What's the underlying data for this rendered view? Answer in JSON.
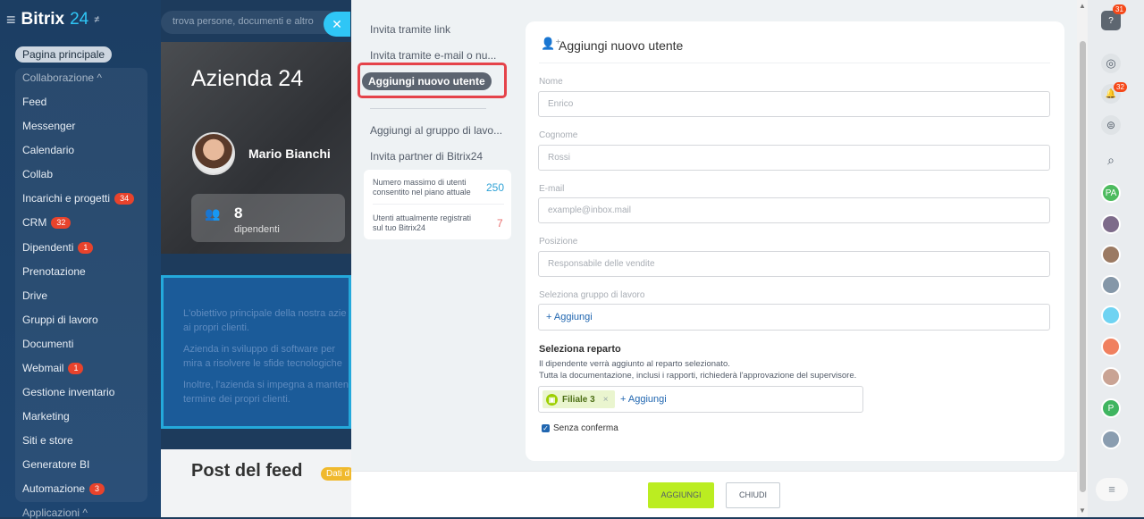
{
  "sidebar": {
    "logo_text": "Bitrix",
    "logo_num": "24",
    "home": "Pagina principale",
    "items": [
      {
        "label": "Collaborazione ^",
        "group": true
      },
      {
        "label": "Feed"
      },
      {
        "label": "Messenger"
      },
      {
        "label": "Calendario"
      },
      {
        "label": "Collab"
      },
      {
        "label": "Incarichi e progetti",
        "count": "34"
      },
      {
        "label": "CRM",
        "count": "32"
      },
      {
        "label": "Dipendenti",
        "count": "1"
      },
      {
        "label": "Prenotazione"
      },
      {
        "label": "Drive"
      },
      {
        "label": "Gruppi di lavoro"
      },
      {
        "label": "Documenti"
      },
      {
        "label": "Webmail",
        "count": "1"
      },
      {
        "label": "Gestione inventario"
      },
      {
        "label": "Marketing"
      },
      {
        "label": "Siti e store"
      },
      {
        "label": "Generatore BI"
      },
      {
        "label": "Automazione",
        "count": "3"
      },
      {
        "label": "Applicazioni ^",
        "group": true
      }
    ]
  },
  "search": {
    "placeholder": "trova persone, documenti e altro"
  },
  "background": {
    "company": "Azienda 24",
    "user": "Mario Bianchi",
    "employees_count": "8",
    "employees_label": "dipendenti",
    "blue_lines": [
      "L'obiettivo principale della nostra azie",
      "ai propri clienti.",
      "Azienda in sviluppo di software per",
      "mira a risolvere le sfide tecnologiche",
      "Inoltre, l'azienda si impegna a manten",
      "termine dei propri clienti."
    ],
    "feed_title": "Post del feed",
    "feed_badge": "Dati d"
  },
  "invite_menu": {
    "items": [
      "Invita tramite link",
      "Invita tramite e-mail o nu...",
      "Aggiungi nuovo utente",
      "Aggiungi al gruppo di lavo...",
      "Invita partner di Bitrix24"
    ],
    "stats": [
      {
        "label": "Numero massimo di utenti consentito nel piano attuale",
        "value": "250",
        "color": "#2fa2d6"
      },
      {
        "label": "Utenti attualmente registrati sul tuo Bitrix24",
        "value": "7",
        "color": "#e86e6e"
      }
    ]
  },
  "form": {
    "title": "Aggiungi nuovo utente",
    "fields": [
      {
        "label": "Nome",
        "placeholder": "Enrico"
      },
      {
        "label": "Cognome",
        "placeholder": "Rossi"
      },
      {
        "label": "E-mail",
        "placeholder": "example@inbox.mail"
      },
      {
        "label": "Posizione",
        "placeholder": "Responsabile delle vendite"
      }
    ],
    "workgroup_label": "Seleziona gruppo di lavoro",
    "add_label": "+ Aggiungi",
    "dept_title": "Seleziona reparto",
    "dept_desc1": "Il dipendente verrà aggiunto al reparto selezionato.",
    "dept_desc2": "Tutta la documentazione, inclusi i rapporti, richiederà l'approvazione del supervisore.",
    "dept_tag": "Filiale 3",
    "checkbox_label": "Senza conferma"
  },
  "footer": {
    "add": "AGGIUNGI",
    "close": "CHIUDI"
  },
  "rightbar": {
    "help_badge": "31",
    "notif_badge": "32",
    "avatars": [
      {
        "initials": "PA",
        "color": "#4dbb5f"
      },
      {
        "initials": "",
        "color": "#7d6b8a"
      },
      {
        "initials": "",
        "color": "#9b7a63"
      },
      {
        "initials": "",
        "color": "#8597a8"
      },
      {
        "initials": "",
        "color": "#6fd3f2"
      },
      {
        "initials": "",
        "color": "#f0805f"
      },
      {
        "initials": "",
        "color": "#c9a394"
      },
      {
        "initials": "P",
        "color": "#3fb560"
      },
      {
        "initials": "",
        "color": "#8a9db0"
      }
    ]
  }
}
